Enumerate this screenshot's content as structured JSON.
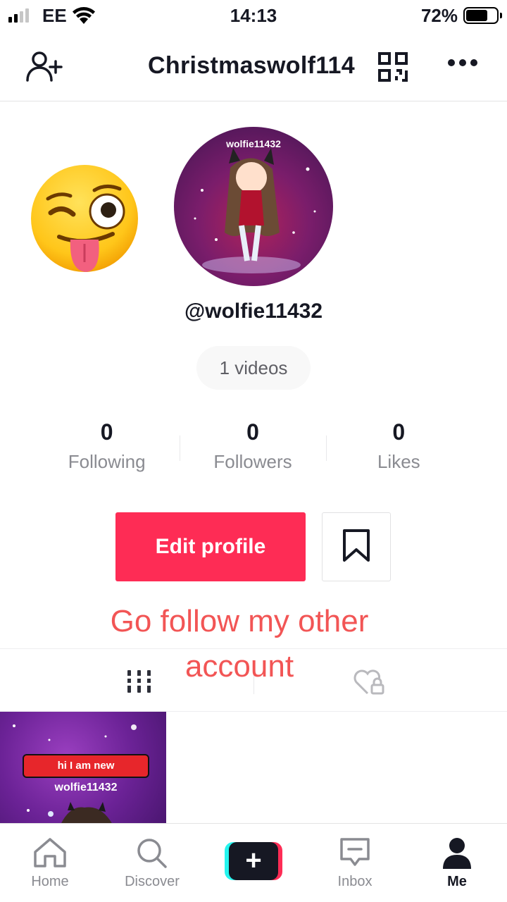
{
  "status_bar": {
    "carrier": "EE",
    "time": "14:13",
    "battery_percent": "72%",
    "battery_level": 0.72,
    "signal_bars": 2
  },
  "header": {
    "title": "Christmaswolf114",
    "icons": [
      "add-user-icon",
      "qr-code-icon",
      "more-options-icon"
    ]
  },
  "profile": {
    "avatar_overlay_text": "wolfie11432",
    "username": "@wolfie11432",
    "videos_count_label": "1 videos",
    "stats": [
      {
        "value": "0",
        "label": "Following"
      },
      {
        "value": "0",
        "label": "Followers"
      },
      {
        "value": "0",
        "label": "Likes"
      }
    ],
    "edit_profile_label": "Edit profile"
  },
  "caption": {
    "line1": "Go follow my other",
    "line2": "account"
  },
  "videos": [
    {
      "badge_text": "hi I am new",
      "user_text": "wolfie11432"
    }
  ],
  "bottom_nav": [
    {
      "label": "Home",
      "icon": "home-icon",
      "active": false
    },
    {
      "label": "Discover",
      "icon": "search-icon",
      "active": false
    },
    {
      "label": "",
      "icon": "create-icon",
      "active": false
    },
    {
      "label": "Inbox",
      "icon": "inbox-icon",
      "active": false
    },
    {
      "label": "Me",
      "icon": "profile-icon",
      "active": true
    }
  ],
  "colors": {
    "accent": "#fe2c55",
    "caption_red": "#f25555",
    "text_dark": "#161823",
    "text_muted": "#8a8b91"
  }
}
